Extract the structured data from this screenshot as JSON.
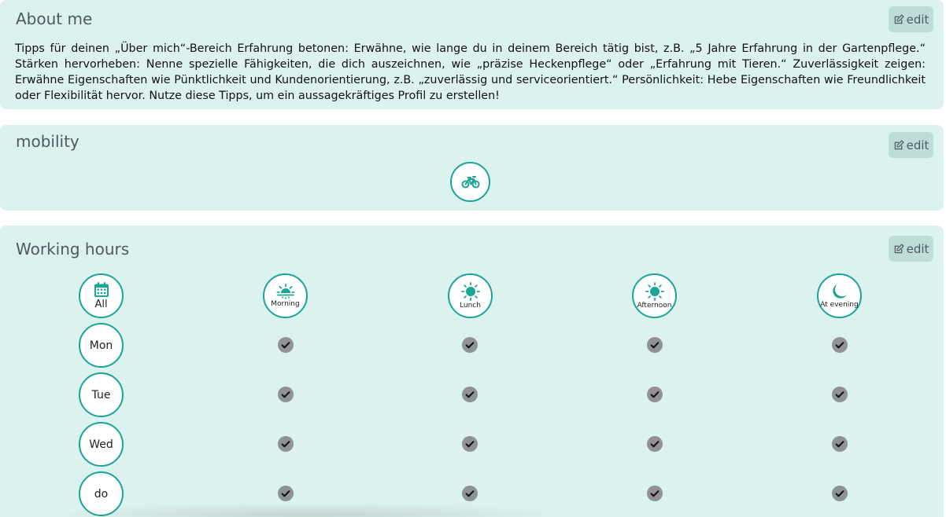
{
  "about": {
    "title": "About me",
    "edit_label": "edit",
    "text": "Tipps für deinen „Über mich“-Bereich Erfahrung betonen: Erwähne, wie lange du in deinem Bereich tätig bist, z.B. „5 Jahre Erfahrung in der Gartenpflege.“ Stärken hervorheben: Nenne spezielle Fähigkeiten, die dich auszeichnen, wie „präzise Heckenpflege“ oder „Erfahrung mit Tieren.“ Zuverlässigkeit zeigen: Erwähne Eigenschaften wie Pünktlichkeit und Kundenorientierung, z.B. „zuverlässig und serviceorientiert.“ Persönlichkeit: Hebe Eigenschaften wie Freundlichkeit oder Flexibilität hervor.  Nutze diese Tipps, um ein aussagekräftiges Profil zu erstellen!"
  },
  "mobility": {
    "title": "mobility",
    "edit_label": "edit",
    "icon": "bicycle-icon"
  },
  "hours": {
    "title": "Working hours",
    "edit_label": "edit",
    "all_label": "All",
    "slots": [
      {
        "label": "Morning",
        "icon": "sunrise-icon"
      },
      {
        "label": "Lunch",
        "icon": "sun-icon"
      },
      {
        "label": "Afternoon",
        "icon": "sun-icon"
      },
      {
        "label": "At evening",
        "icon": "moon-icon"
      }
    ],
    "days": [
      {
        "label": "Mon",
        "checked": [
          true,
          true,
          true,
          true
        ]
      },
      {
        "label": "Tue",
        "checked": [
          true,
          true,
          true,
          true
        ]
      },
      {
        "label": "Wed",
        "checked": [
          true,
          true,
          true,
          true
        ]
      },
      {
        "label": "do",
        "checked": [
          true,
          true,
          true,
          true
        ]
      }
    ]
  },
  "colors": {
    "accent": "#1aa596",
    "card_bg": "#dcf2ee",
    "check_bg": "#8f9296"
  }
}
